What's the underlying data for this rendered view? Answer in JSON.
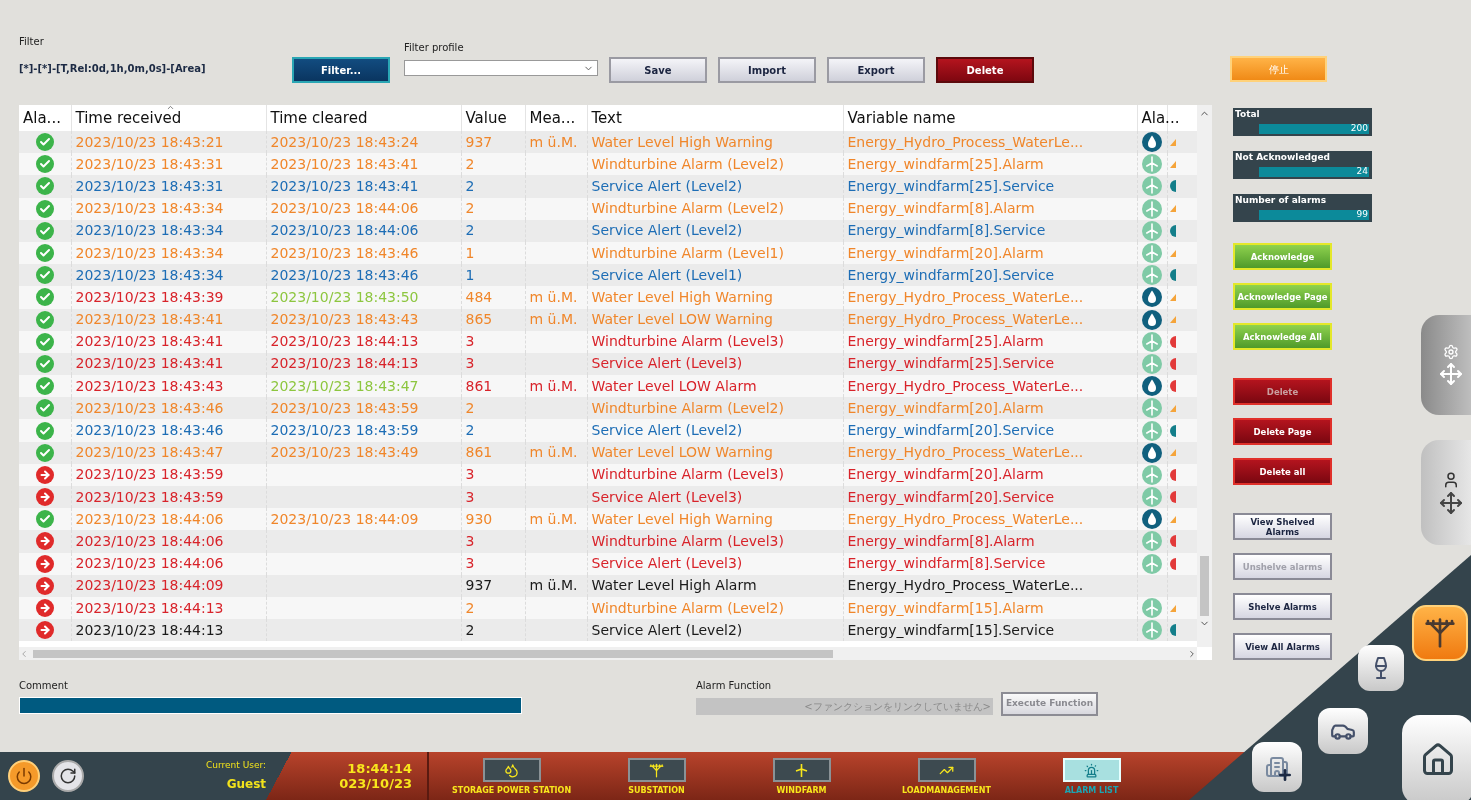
{
  "filter": {
    "label": "Filter",
    "expression": "[*]-[*]-[T,Rel:0d,1h,0m,0s]-[Area]",
    "button": "Filter..."
  },
  "filter_profile": {
    "label": "Filter profile"
  },
  "toolbar": [
    {
      "label": "Save",
      "kind": "plain"
    },
    {
      "label": "Import",
      "kind": "plain"
    },
    {
      "label": "Export",
      "kind": "plain"
    },
    {
      "label": "Delete",
      "kind": "danger"
    }
  ],
  "stop_button": "停止",
  "table": {
    "columns": [
      "Ala...",
      "Time received",
      "Time cleared",
      "Value",
      "Mea...",
      "Text",
      "Variable name",
      "Ala..."
    ],
    "rows": [
      {
        "acknowledged": true,
        "received": {
          "text": "2023/10/23 18:43:21",
          "color": "#f0862a"
        },
        "cleared": {
          "text": "2023/10/23 18:43:24",
          "color": "#f0862a"
        },
        "value": "937",
        "measure": "m ü.M.",
        "text": "Water Level High Warning",
        "variable": "Energy_Hydro_Process_WaterLe...",
        "kind": "water",
        "marker": {
          "kind": "triangle",
          "color": "#f5a43a"
        },
        "color": "#f0862a"
      },
      {
        "acknowledged": true,
        "received": {
          "text": "2023/10/23 18:43:31",
          "color": "#f0862a"
        },
        "cleared": {
          "text": "2023/10/23 18:43:41",
          "color": "#f0862a"
        },
        "value": "2",
        "text": "Windturbine Alarm (Level2)",
        "variable": "Energy_windfarm[25].Alarm",
        "kind": "wind",
        "marker": {
          "kind": "triangle",
          "color": "#f5a43a"
        },
        "color": "#f0862a"
      },
      {
        "acknowledged": true,
        "received": {
          "text": "2023/10/23 18:43:31",
          "color": "#1d6db5"
        },
        "cleared": {
          "text": "2023/10/23 18:43:41",
          "color": "#1d6db5"
        },
        "value": "2",
        "text": "Service Alert (Level2)",
        "variable": "Energy_windfarm[25].Service",
        "kind": "wind",
        "marker": {
          "kind": "circle",
          "color": "#137e8a"
        },
        "color": "#1d6db5"
      },
      {
        "acknowledged": true,
        "received": {
          "text": "2023/10/23 18:43:34",
          "color": "#f0862a"
        },
        "cleared": {
          "text": "2023/10/23 18:44:06",
          "color": "#f0862a"
        },
        "value": "2",
        "text": "Windturbine Alarm (Level2)",
        "variable": "Energy_windfarm[8].Alarm",
        "kind": "wind",
        "marker": {
          "kind": "triangle",
          "color": "#f5a43a"
        },
        "color": "#f0862a"
      },
      {
        "acknowledged": true,
        "received": {
          "text": "2023/10/23 18:43:34",
          "color": "#1d6db5"
        },
        "cleared": {
          "text": "2023/10/23 18:44:06",
          "color": "#1d6db5"
        },
        "value": "2",
        "text": "Service Alert (Level2)",
        "variable": "Energy_windfarm[8].Service",
        "kind": "wind",
        "marker": {
          "kind": "circle",
          "color": "#137e8a"
        },
        "color": "#1d6db5"
      },
      {
        "acknowledged": true,
        "received": {
          "text": "2023/10/23 18:43:34",
          "color": "#f0862a"
        },
        "cleared": {
          "text": "2023/10/23 18:43:46",
          "color": "#f0862a"
        },
        "value": "1",
        "text": "Windturbine Alarm (Level1)",
        "variable": "Energy_windfarm[20].Alarm",
        "kind": "wind",
        "marker": {
          "kind": "triangle",
          "color": "#f5a43a"
        },
        "color": "#f0862a"
      },
      {
        "acknowledged": true,
        "received": {
          "text": "2023/10/23 18:43:34",
          "color": "#1d6db5"
        },
        "cleared": {
          "text": "2023/10/23 18:43:46",
          "color": "#1d6db5"
        },
        "value": "1",
        "text": "Service Alert (Level1)",
        "variable": "Energy_windfarm[20].Service",
        "kind": "wind",
        "marker": {
          "kind": "circle",
          "color": "#137e8a"
        },
        "color": "#1d6db5"
      },
      {
        "acknowledged": true,
        "received": {
          "text": "2023/10/23 18:43:39",
          "color": "#d8232a"
        },
        "cleared": {
          "text": "2023/10/23 18:43:50",
          "color": "#8dc63f"
        },
        "value": "484",
        "measure": "m ü.M.",
        "text": "Water Level High Warning",
        "variable": "Energy_Hydro_Process_WaterLe...",
        "kind": "water",
        "marker": {
          "kind": "triangle",
          "color": "#f5a43a"
        },
        "color": "#f0862a"
      },
      {
        "acknowledged": true,
        "received": {
          "text": "2023/10/23 18:43:41",
          "color": "#f0862a"
        },
        "cleared": {
          "text": "2023/10/23 18:43:43",
          "color": "#f0862a"
        },
        "value": "865",
        "measure": "m ü.M.",
        "text": "Water Level LOW Warning",
        "variable": "Energy_Hydro_Process_WaterLe...",
        "kind": "water",
        "marker": {
          "kind": "triangle",
          "color": "#f5a43a"
        },
        "color": "#f0862a"
      },
      {
        "acknowledged": true,
        "received": {
          "text": "2023/10/23 18:43:41",
          "color": "#d8232a"
        },
        "cleared": {
          "text": "2023/10/23 18:44:13",
          "color": "#d8232a"
        },
        "value": "3",
        "text": "Windturbine Alarm (Level3)",
        "variable": "Energy_windfarm[25].Alarm",
        "kind": "wind",
        "marker": {
          "kind": "circle",
          "color": "#e23a3a"
        },
        "color": "#d8232a"
      },
      {
        "acknowledged": true,
        "received": {
          "text": "2023/10/23 18:43:41",
          "color": "#d8232a"
        },
        "cleared": {
          "text": "2023/10/23 18:44:13",
          "color": "#d8232a"
        },
        "value": "3",
        "text": "Service Alert (Level3)",
        "variable": "Energy_windfarm[25].Service",
        "kind": "wind",
        "marker": {
          "kind": "circle",
          "color": "#e23a3a"
        },
        "color": "#d8232a"
      },
      {
        "acknowledged": true,
        "received": {
          "text": "2023/10/23 18:43:43",
          "color": "#d8232a"
        },
        "cleared": {
          "text": "2023/10/23 18:43:47",
          "color": "#8dc63f"
        },
        "value": "861",
        "measure": "m ü.M.",
        "text": "Water Level LOW Alarm",
        "variable": "Energy_Hydro_Process_WaterLe...",
        "kind": "water",
        "marker": {
          "kind": "circle",
          "color": "#e23a3a"
        },
        "color": "#d8232a"
      },
      {
        "acknowledged": true,
        "received": {
          "text": "2023/10/23 18:43:46",
          "color": "#f0862a"
        },
        "cleared": {
          "text": "2023/10/23 18:43:59",
          "color": "#f0862a"
        },
        "value": "2",
        "text": "Windturbine Alarm (Level2)",
        "variable": "Energy_windfarm[20].Alarm",
        "kind": "wind",
        "marker": {
          "kind": "triangle",
          "color": "#f5a43a"
        },
        "color": "#f0862a"
      },
      {
        "acknowledged": true,
        "received": {
          "text": "2023/10/23 18:43:46",
          "color": "#1d6db5"
        },
        "cleared": {
          "text": "2023/10/23 18:43:59",
          "color": "#1d6db5"
        },
        "value": "2",
        "text": "Service Alert (Level2)",
        "variable": "Energy_windfarm[20].Service",
        "kind": "wind",
        "marker": {
          "kind": "circle",
          "color": "#137e8a"
        },
        "color": "#1d6db5"
      },
      {
        "acknowledged": true,
        "received": {
          "text": "2023/10/23 18:43:47",
          "color": "#f0862a"
        },
        "cleared": {
          "text": "2023/10/23 18:43:49",
          "color": "#f0862a"
        },
        "value": "861",
        "measure": "m ü.M.",
        "text": "Water Level LOW Warning",
        "variable": "Energy_Hydro_Process_WaterLe...",
        "kind": "water",
        "marker": {
          "kind": "triangle",
          "color": "#f5a43a"
        },
        "color": "#f0862a"
      },
      {
        "acknowledged": false,
        "received": {
          "text": "2023/10/23 18:43:59",
          "color": "#d8232a"
        },
        "value": "3",
        "text": "Windturbine Alarm (Level3)",
        "variable": "Energy_windfarm[20].Alarm",
        "kind": "wind",
        "marker": {
          "kind": "circle",
          "color": "#e23a3a"
        },
        "color": "#d8232a"
      },
      {
        "acknowledged": false,
        "received": {
          "text": "2023/10/23 18:43:59",
          "color": "#d8232a"
        },
        "value": "3",
        "text": "Service Alert (Level3)",
        "variable": "Energy_windfarm[20].Service",
        "kind": "wind",
        "marker": {
          "kind": "circle",
          "color": "#e23a3a"
        },
        "color": "#d8232a"
      },
      {
        "acknowledged": true,
        "received": {
          "text": "2023/10/23 18:44:06",
          "color": "#f0862a"
        },
        "cleared": {
          "text": "2023/10/23 18:44:09",
          "color": "#f0862a"
        },
        "value": "930",
        "measure": "m ü.M.",
        "text": "Water Level High Warning",
        "variable": "Energy_Hydro_Process_WaterLe...",
        "kind": "water",
        "marker": {
          "kind": "triangle",
          "color": "#f5a43a"
        },
        "color": "#f0862a"
      },
      {
        "acknowledged": false,
        "received": {
          "text": "2023/10/23 18:44:06",
          "color": "#d8232a"
        },
        "value": "3",
        "text": "Windturbine Alarm (Level3)",
        "variable": "Energy_windfarm[8].Alarm",
        "kind": "wind",
        "marker": {
          "kind": "circle",
          "color": "#e23a3a"
        },
        "color": "#d8232a"
      },
      {
        "acknowledged": false,
        "received": {
          "text": "2023/10/23 18:44:06",
          "color": "#d8232a"
        },
        "value": "3",
        "text": "Service Alert (Level3)",
        "variable": "Energy_windfarm[8].Service",
        "kind": "wind",
        "marker": {
          "kind": "circle",
          "color": "#e23a3a"
        },
        "color": "#d8232a"
      },
      {
        "acknowledged": false,
        "received": {
          "text": "2023/10/23 18:44:09",
          "color": "#d8232a"
        },
        "value": "937",
        "measure": "m ü.M.",
        "text": "Water Level High Alarm",
        "variable": "Energy_Hydro_Process_WaterLe...",
        "color": "#1a1a1a"
      },
      {
        "acknowledged": false,
        "received": {
          "text": "2023/10/23 18:44:13",
          "color": "#d8232a"
        },
        "value": "2",
        "text": "Windturbine Alarm (Level2)",
        "variable": "Energy_windfarm[15].Alarm",
        "kind": "wind",
        "marker": {
          "kind": "triangle",
          "color": "#f5a43a"
        },
        "color": "#f0862a"
      },
      {
        "acknowledged": false,
        "received": {
          "text": "2023/10/23 18:44:13",
          "color": "#1a1a1a"
        },
        "value": "2",
        "text": "Service Alert (Level2)",
        "variable": "Energy_windfarm[15].Service",
        "kind": "wind",
        "marker": {
          "kind": "circle",
          "color": "#137e8a"
        },
        "color": "#1a1a1a"
      }
    ]
  },
  "stats": [
    {
      "label": "Total",
      "value": "200",
      "level": 1
    },
    {
      "label": "Not Acknowledged",
      "value": "24",
      "level": 1
    },
    {
      "label": "Number of alarms",
      "value": "99",
      "level": 1
    }
  ],
  "action_groups": [
    [
      {
        "label": "Acknowledge",
        "kind": "green",
        "disabled": false
      },
      {
        "label": "Acknowledge Page",
        "kind": "green",
        "disabled": false
      },
      {
        "label": "Acknowledge All",
        "kind": "green",
        "disabled": false
      }
    ],
    [
      {
        "label": "Delete",
        "kind": "red",
        "disabled": true
      },
      {
        "label": "Delete Page",
        "kind": "red",
        "disabled": false
      },
      {
        "label": "Delete all",
        "kind": "red",
        "disabled": false
      }
    ],
    [
      {
        "label": "View Shelved Alarms",
        "kind": "white",
        "disabled": false
      },
      {
        "label": "Unshelve alarms",
        "kind": "white",
        "disabled": true
      },
      {
        "label": "Shelve Alarms",
        "kind": "white",
        "disabled": false
      },
      {
        "label": "View All Alarms",
        "kind": "white",
        "disabled": false
      }
    ]
  ],
  "comment": {
    "label": "Comment"
  },
  "alarm_function": {
    "label": "Alarm Function",
    "placeholder": "<ファンクションをリンクしていません>",
    "button": "Execute Function"
  },
  "footer": {
    "user_label": "Current User:",
    "user": "Guest",
    "time": "18:44:14",
    "date": "023/10/23",
    "nav": [
      {
        "label": "STORAGE POWER STATION",
        "selected": false
      },
      {
        "label": "SUBSTATION",
        "selected": false
      },
      {
        "label": "WINDFARM",
        "selected": false
      },
      {
        "label": "LOADMANAGEMENT",
        "selected": false
      },
      {
        "label": "ALARM LIST",
        "selected": true
      }
    ]
  }
}
